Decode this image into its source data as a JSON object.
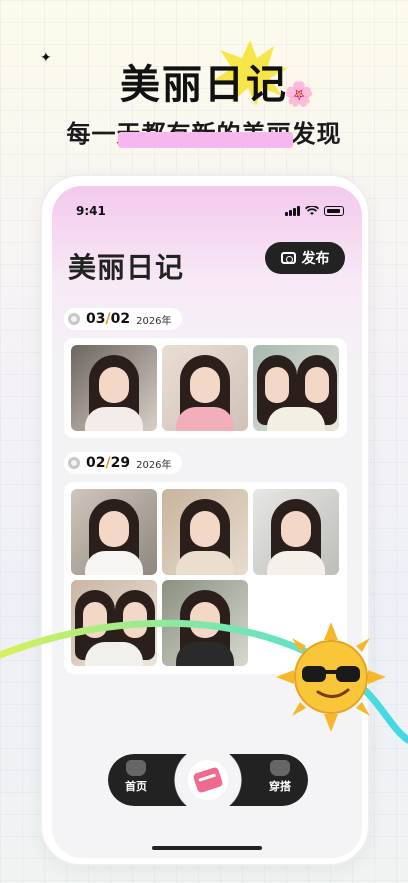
{
  "hero": {
    "title": "美丽日记",
    "subtitle": "每一天都有新的美丽发现"
  },
  "status": {
    "time": "9:41"
  },
  "header": {
    "title": "美丽日记",
    "publish_label": "发布"
  },
  "entries": [
    {
      "month_day_a": "03",
      "sep": "/",
      "month_day_b": "02",
      "year": "2026年",
      "photo_count": 3
    },
    {
      "month_day_a": "02",
      "sep": "/",
      "month_day_b": "29",
      "year": "2026年",
      "photo_count": 5
    }
  ],
  "nav": {
    "left_label": "首页",
    "right_label": "穿搭",
    "left_icon": "home-cat-icon",
    "center_icon": "add-entry-icon",
    "right_icon": "outfit-icon"
  },
  "colors": {
    "accent": "#e6932b",
    "dark": "#222222",
    "highlight": "#f7b6ee"
  }
}
